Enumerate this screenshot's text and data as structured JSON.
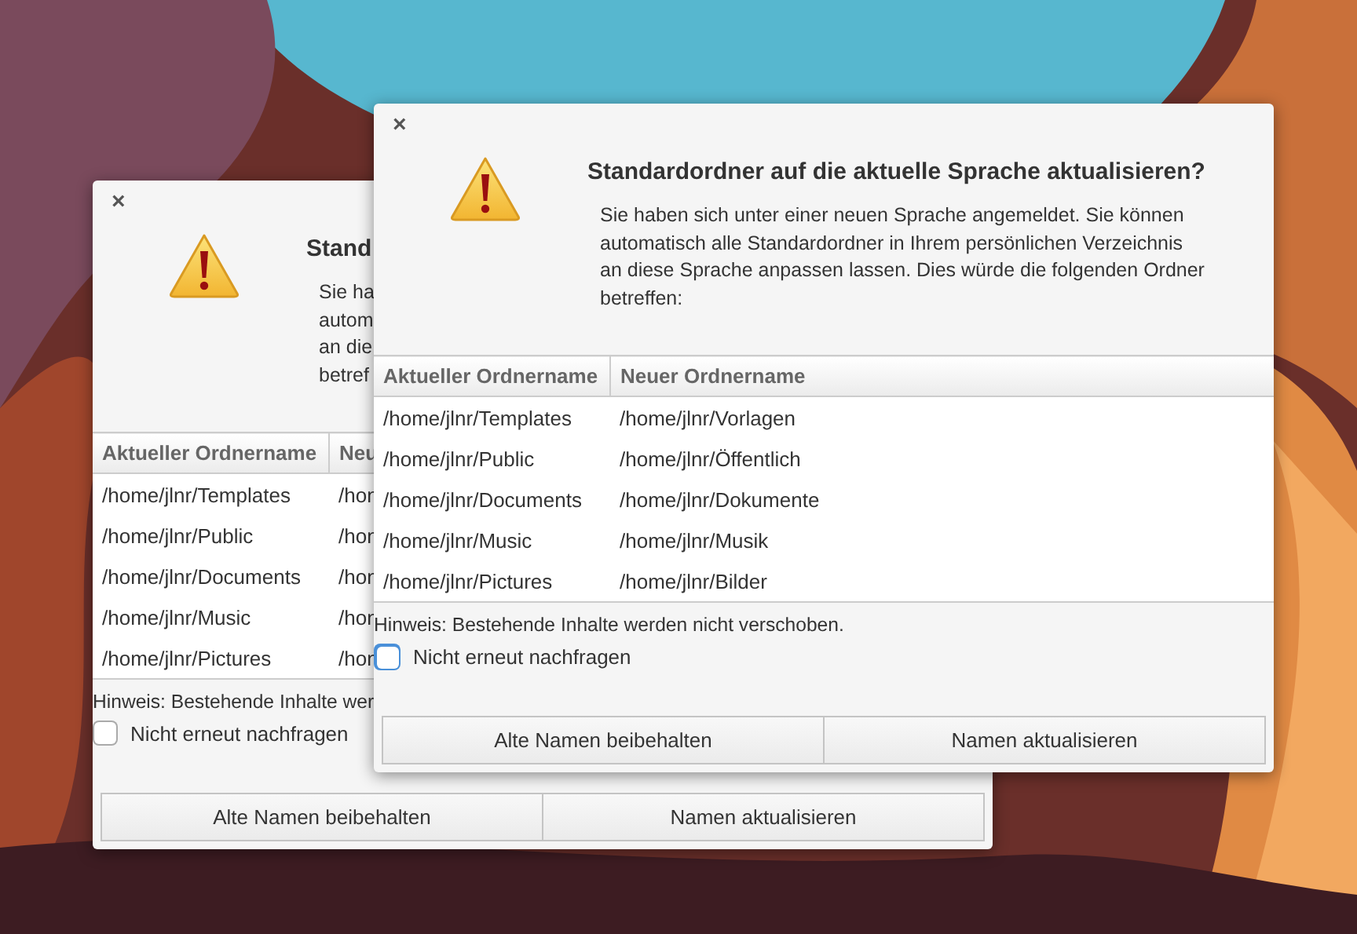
{
  "windows": [
    {
      "close": "×",
      "title": "Stand",
      "description_lines": [
        "Sie ha",
        "autom",
        "an die",
        "betref"
      ],
      "table": {
        "columns": [
          "Aktueller Ordnername",
          "Neu"
        ],
        "rows": [
          [
            "/home/jlnr/Templates",
            "/hon"
          ],
          [
            "/home/jlnr/Public",
            "/hon"
          ],
          [
            "/home/jlnr/Documents",
            "/hon"
          ],
          [
            "/home/jlnr/Music",
            "/hon"
          ],
          [
            "/home/jlnr/Pictures",
            "/hon"
          ]
        ]
      },
      "hint": "Hinweis: Bestehende Inhalte wer",
      "checkbox": {
        "label": "Nicht erneut nachfragen",
        "checked": false,
        "focused": false
      },
      "buttons": [
        "Alte Namen beibehalten",
        "Namen aktualisieren"
      ]
    },
    {
      "close": "×",
      "title": "Standardordner auf die aktuelle Sprache aktualisieren?",
      "description": "Sie haben sich unter einer neuen Sprache angemeldet. Sie können automatisch alle Standardordner in Ihrem persönlichen Verzeichnis an diese Sprache anpassen lassen. Dies würde die folgenden Ordner betreffen:",
      "table": {
        "columns": [
          "Aktueller Ordnername",
          "Neuer Ordnername"
        ],
        "rows": [
          [
            "/home/jlnr/Templates",
            "/home/jlnr/Vorlagen"
          ],
          [
            "/home/jlnr/Public",
            "/home/jlnr/Öffentlich"
          ],
          [
            "/home/jlnr/Documents",
            "/home/jlnr/Dokumente"
          ],
          [
            "/home/jlnr/Music",
            "/home/jlnr/Musik"
          ],
          [
            "/home/jlnr/Pictures",
            "/home/jlnr/Bilder"
          ]
        ]
      },
      "hint": "Hinweis: Bestehende Inhalte werden nicht verschoben.",
      "checkbox": {
        "label": "Nicht erneut nachfragen",
        "checked": false,
        "focused": true
      },
      "buttons": [
        "Alte Namen beibehalten",
        "Namen aktualisieren"
      ]
    }
  ]
}
